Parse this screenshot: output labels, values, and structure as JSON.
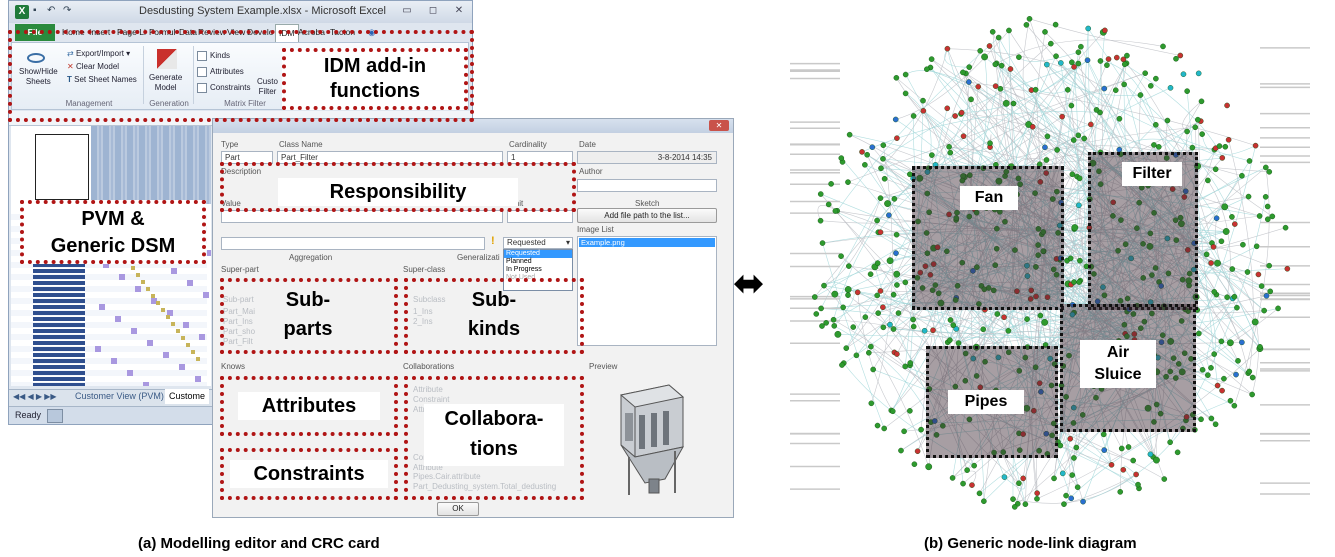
{
  "excel": {
    "title": "Desdusting System Example.xlsx - Microsoft Excel",
    "tabs": [
      "File",
      "Home",
      "Insert",
      "Page Li",
      "Formul",
      "Data",
      "Review",
      "View",
      "Develo",
      "IDM",
      "Acroba",
      "Tacton"
    ],
    "ribbon": {
      "show_hide": "Show/Hide\nSheets",
      "export_import": "Export/Import",
      "clear_model": "Clear Model",
      "set_sheet_names": "Set Sheet Names",
      "generate_model": "Generate\nModel",
      "kinds": "Kinds",
      "attributes": "Attributes",
      "constraints": "Constraints",
      "custom_filter": "Custo\nFilter",
      "group_management": "Management",
      "group_generation": "Generation",
      "group_matrix_filter": "Matrix Filter"
    },
    "sheet_tabs": [
      "Customer View (PVM)",
      "Custome"
    ],
    "status": "Ready"
  },
  "crc": {
    "type_label": "Type",
    "type_value": "Part",
    "class_name_label": "Class Name",
    "class_name_value": "Part_Filter",
    "cardinality_label": "Cardinality",
    "cardinality_value": "1",
    "date_label": "Date",
    "date_value": "3-8-2014 14:35",
    "description_label": "Description",
    "author_label": "Author",
    "value_label": "Value",
    "unit_label": "Unit",
    "sketch_label": "Sketch",
    "add_file_button": "Add file path to the list...",
    "image_list_label": "Image List",
    "image_list_item": "Example.png",
    "status_options": [
      "Requested",
      "Planned",
      "In Progress",
      "Not Used"
    ],
    "status_selected": "Requested",
    "aggregation_label": "Aggregation",
    "generalization_label": "Generalizati",
    "super_part_label": "Super-part",
    "super_class_label": "Super-class",
    "sub_part_label": "Sub-part",
    "subclass_label": "Subclass",
    "knows_label": "Knows",
    "collaborations_label": "Collaborations",
    "preview_label": "Preview",
    "ok_button": "OK",
    "faint_sub_parts": [
      "Part_Mai",
      "Part_Ins",
      "Part_sho",
      "Part_Filt"
    ],
    "faint_sub_kinds": [
      "1_Ins",
      "2_Ins"
    ],
    "faint_collab": [
      "Attribute",
      "Constraint",
      "Attribute",
      "Constraint",
      "Attribute"
    ],
    "faint_collab_bottom": [
      "Pipes.Cair.attribute",
      "Part_Dedusting_system.Total_dedusting"
    ]
  },
  "callouts": {
    "idm": "IDM add-in\nfunctions",
    "pvm": "PVM &\nGeneric DSM",
    "responsibility": "Responsibility",
    "subparts": "Sub-\nparts",
    "subkinds": "Sub-\nkinds",
    "attributes": "Attributes",
    "collaborations": "Collabora-\ntions",
    "constraints": "Constraints"
  },
  "graph_labels": {
    "fan": "Fan",
    "filter": "Filter",
    "air_sluice": "Air\nSluice",
    "pipes": "Pipes"
  },
  "double_arrow": "⬌",
  "captions": {
    "left": "(a)  Modelling editor and CRC card",
    "right": "(b)  Generic node-link diagram"
  }
}
